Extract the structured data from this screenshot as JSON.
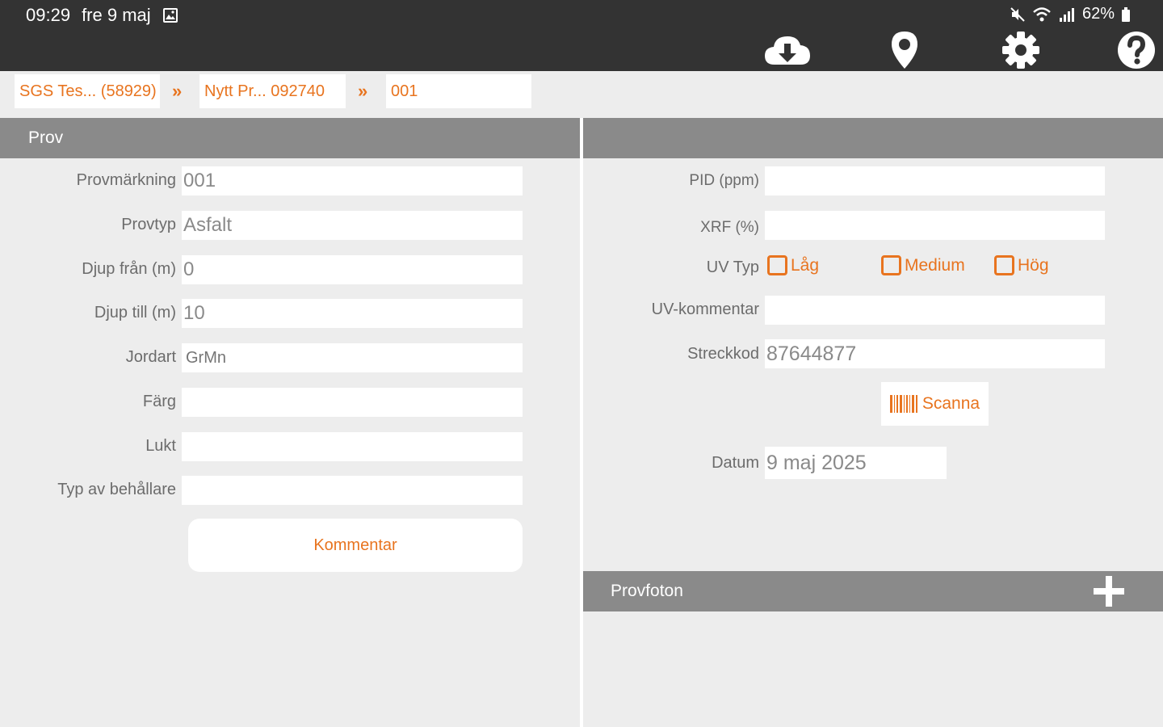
{
  "status_bar": {
    "time": "09:29",
    "date": "fre 9 maj",
    "battery": "62%"
  },
  "toolbar": {
    "icons": [
      "cloud-download-icon",
      "location-pin-icon",
      "gear-icon",
      "help-icon"
    ]
  },
  "breadcrumb": {
    "items": [
      "SGS Tes... (58929)",
      "Nytt Pr... 092740",
      "001"
    ],
    "separator": "»"
  },
  "left_panel": {
    "title": "Prov",
    "fields": [
      {
        "label": "Provmärkning",
        "value": "001"
      },
      {
        "label": "Provtyp",
        "value": "Asfalt"
      },
      {
        "label": "Djup från (m)",
        "value": "0"
      },
      {
        "label": "Djup till (m)",
        "value": "10"
      },
      {
        "label": "Jordart",
        "value": "",
        "placeholder": "GrMn"
      },
      {
        "label": "Färg",
        "value": ""
      },
      {
        "label": "Lukt",
        "value": ""
      },
      {
        "label": "Typ av behållare",
        "value": ""
      }
    ],
    "kommentar_label": "Kommentar"
  },
  "right_panel": {
    "title": "",
    "pid": {
      "label": "PID (ppm)",
      "value": ""
    },
    "xrf": {
      "label": "XRF (%)",
      "value": ""
    },
    "uv_typ": {
      "label": "UV Typ",
      "options": [
        "Låg",
        "Medium",
        "Hög"
      ]
    },
    "uv_kommentar": {
      "label": "UV-kommentar",
      "value": ""
    },
    "streckkod": {
      "label": "Streckkod",
      "value": "87644877"
    },
    "scan_label": "Scanna",
    "datum": {
      "label": "Datum",
      "value": "9 maj 2025"
    }
  },
  "photos": {
    "title": "Provfoton",
    "add_icon": "plus-icon"
  },
  "colors": {
    "accent": "#e8741f",
    "topbar": "#333333",
    "header": "#8a8a8a",
    "background": "#ededed"
  }
}
